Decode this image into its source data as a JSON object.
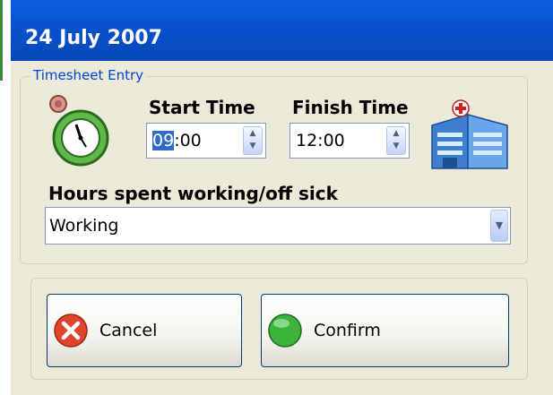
{
  "window": {
    "title": "24 July 2007"
  },
  "timesheet": {
    "group_label": "Timesheet Entry",
    "start_label": "Start Time",
    "finish_label": "Finish Time",
    "start_hours": "09",
    "start_minutes": ":00",
    "finish_value": "12:00",
    "hours_label": "Hours spent working/off sick",
    "hours_selected": "Working"
  },
  "buttons": {
    "cancel_label": "Cancel",
    "confirm_label": "Confirm"
  },
  "icons": {
    "stopwatch": "stopwatch-icon",
    "hospital": "hospital-icon",
    "cancel": "cancel-icon",
    "confirm": "confirm-icon",
    "spin_up": "▲",
    "spin_down": "▼",
    "dropdown": "▼"
  },
  "colors": {
    "titlebar": "#0852cc",
    "group_label": "#0046d5",
    "selection": "#316ac5",
    "cancel_red": "#e0452b",
    "confirm_green": "#3cb43c"
  }
}
